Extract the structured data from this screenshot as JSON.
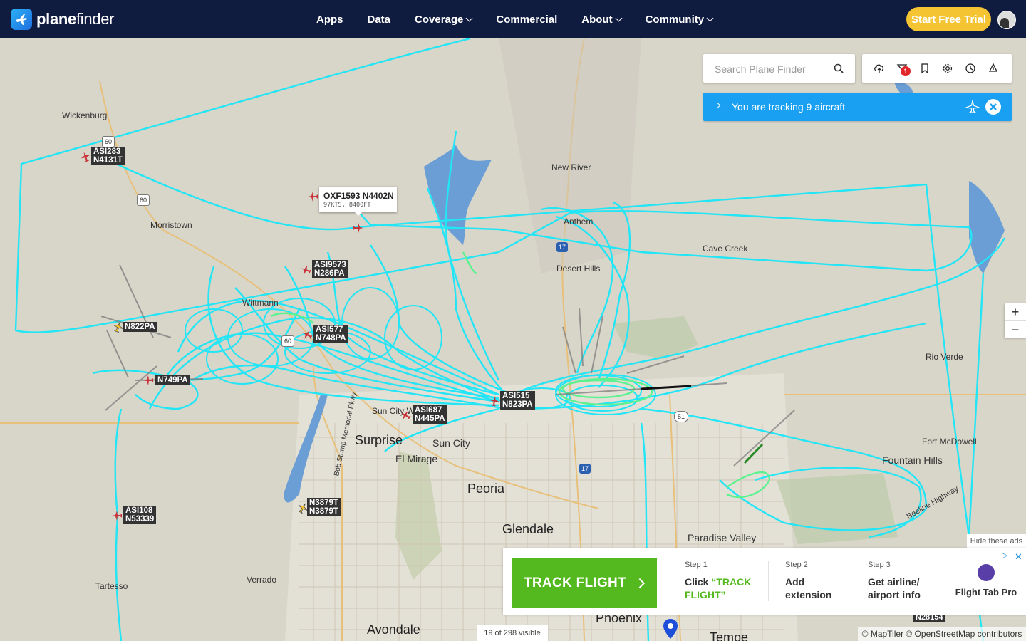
{
  "nav": {
    "brand_plane": "plane",
    "brand_finder": "finder",
    "links": [
      {
        "label": "Apps",
        "dropdown": false
      },
      {
        "label": "Data",
        "dropdown": false
      },
      {
        "label": "Coverage",
        "dropdown": true
      },
      {
        "label": "Commercial",
        "dropdown": false
      },
      {
        "label": "About",
        "dropdown": true
      },
      {
        "label": "Community",
        "dropdown": true
      }
    ],
    "trial_button": "Start Free Trial"
  },
  "search": {
    "placeholder": "Search Plane Finder"
  },
  "toolbar": {
    "filter_badge": "1",
    "icons": [
      "cloud-upload-icon",
      "filter-icon",
      "bookmark-icon",
      "settings-icon",
      "history-icon",
      "playback-icon"
    ]
  },
  "tracking": {
    "text": "You are tracking 9 aircraft"
  },
  "zoom": {
    "in": "+",
    "out": "−"
  },
  "popup": {
    "title": "OXF1593 N4402N",
    "sub": "97KTS, 8400FT"
  },
  "aircraft": [
    {
      "line1": "ASI283",
      "line2": "N4131T"
    },
    {
      "line1": "ASI9573",
      "line2": "N286PA"
    },
    {
      "line1": "N822PA",
      "line2": ""
    },
    {
      "line1": "ASI577",
      "line2": "N748PA"
    },
    {
      "line1": "N749PA",
      "line2": ""
    },
    {
      "line1": "ASI515",
      "line2": "N823PA"
    },
    {
      "line1": "ASI687",
      "line2": "N445PA"
    },
    {
      "line1": "ASI108",
      "line2": "N53339"
    },
    {
      "line1": "N3879T",
      "line2": "N3879T"
    },
    {
      "line1": "N28154",
      "line2": ""
    }
  ],
  "places": {
    "wickenburg": "Wickenburg",
    "morristown": "Morristown",
    "wittmann": "Wittmann",
    "new_river": "New River",
    "anthem": "Anthem",
    "desert_hills": "Desert Hills",
    "cave_creek": "Cave Creek",
    "rio_verde": "Rio Verde",
    "fort_mcdowell": "Fort McDowell",
    "fountain_hills": "Fountain Hills",
    "sun_city_west": "Sun City West",
    "surprise": "Surprise",
    "sun_city": "Sun City",
    "el_mirage": "El Mirage",
    "peoria": "Peoria",
    "glendale": "Glendale",
    "paradise_valley": "Paradise Valley",
    "tartesso": "Tartesso",
    "verrado": "Verrado",
    "avondale": "Avondale",
    "phoenix": "Phoenix",
    "tempe": "Tempe",
    "beeline": "Beeline Highway",
    "bob_stump": "Bob Stump Memorial Pkwy",
    "hwy60a": "60",
    "hwy60b": "60",
    "hwy60c": "60",
    "hwy17a": "17",
    "hwy17b": "17",
    "hwy51": "51"
  },
  "ad": {
    "hide": "Hide these ads",
    "button": "TRACK FLIGHT",
    "steps": [
      {
        "n": "Step 1",
        "d1": "Click ",
        "d_green": "“TRACK FLIGHT”"
      },
      {
        "n": "Step 2",
        "d1": "Add extension",
        "d_green": ""
      },
      {
        "n": "Step 3",
        "d1": "Get airline/ airport info",
        "d_green": ""
      }
    ],
    "product": "Flight Tab Pro",
    "close": "✕"
  },
  "footer": {
    "visible": "19 of 298 visible",
    "attribution": "© MapTiler © OpenStreetMap contributors"
  },
  "colors": {
    "nav": "#0f1b3f",
    "track_cyan": "#22e5f5",
    "track_green": "#5cf28f",
    "accent_blue": "#1aa0f2",
    "trial": "#f4c433",
    "ad_green": "#54b91e",
    "plane_red": "#c8343a",
    "plane_yellow": "#f1c12e",
    "water": "#6a9ed4"
  }
}
